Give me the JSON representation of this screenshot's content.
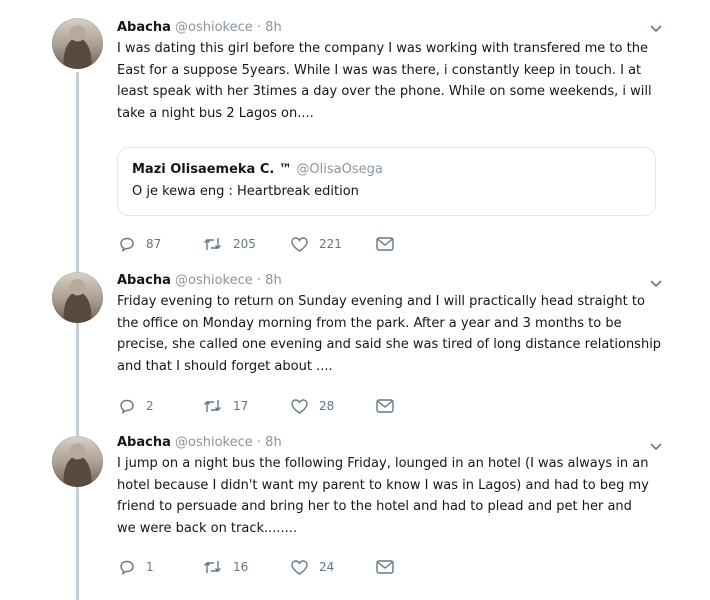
{
  "tweets": [
    {
      "author": "Abacha",
      "handle": "@oshiokece",
      "time": "· 8h",
      "lines": [
        "I was dating this  girl before the company I was working with transfered me to the",
        "East for a suppose 5years. While I was  was there, i constantly keep in touch. I at",
        "least speak with her 3times a day over the phone. While  on some weekends, i will",
        "take a night bus 2 Lagos on...."
      ],
      "quote": {
        "author": "Mazi Olisaemeka C. ™",
        "handle": "@OlisaOsega",
        "text": "O je kewa eng : Heartbreak edition"
      },
      "replies": "87",
      "retweets": "205",
      "likes": "221"
    },
    {
      "author": "Abacha",
      "handle": "@oshiokece",
      "time": "· 8h",
      "lines": [
        "Friday evening  to return on Sunday evening and I will practically head straight to",
        "the office on Monday morning from the park. After a year and 3 months to be",
        "precise, she called one evening and said she was tired of long distance relationship",
        "and that I should forget about ...."
      ],
      "replies": "2",
      "retweets": "17",
      "likes": "28"
    },
    {
      "author": "Abacha",
      "handle": "@oshiokece",
      "time": "· 8h",
      "lines": [
        "I jump on a night bus the following Friday, lounged in an hotel (I was always in an",
        "hotel because I didn't want my parent to know I was in Lagos) and had to beg my",
        "friend to persuade and bring her to the hotel and had to plead and pet her and",
        "we were back on track........"
      ],
      "replies": "1",
      "retweets": "16",
      "likes": "24"
    }
  ]
}
